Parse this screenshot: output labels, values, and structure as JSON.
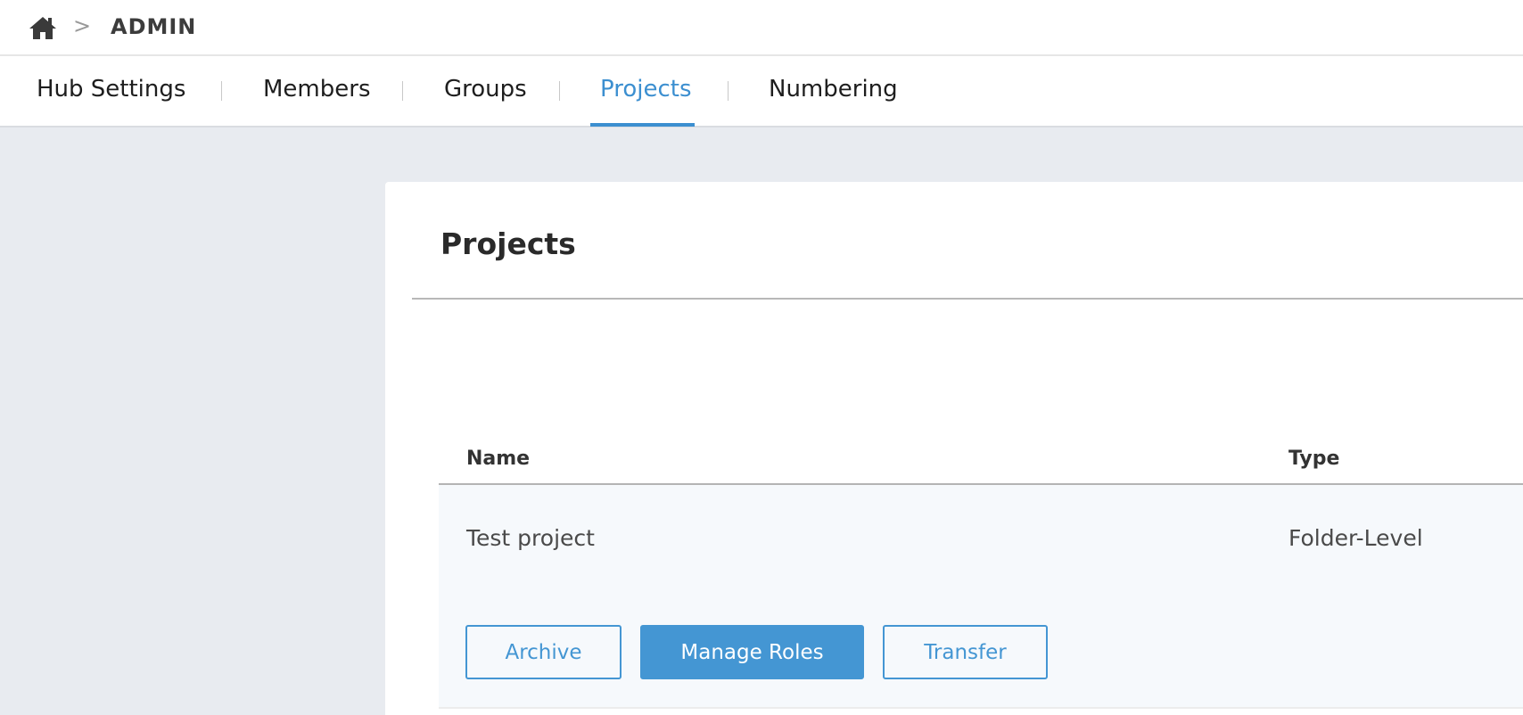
{
  "breadcrumb": {
    "home_icon": "home-icon",
    "separator": ">",
    "current": "ADMIN"
  },
  "tabs": [
    {
      "label": "Hub Settings",
      "active": false
    },
    {
      "label": "Members",
      "active": false
    },
    {
      "label": "Groups",
      "active": false
    },
    {
      "label": "Projects",
      "active": true
    },
    {
      "label": "Numbering",
      "active": false
    }
  ],
  "card": {
    "title": "Projects",
    "columns": {
      "name": "Name",
      "type": "Type"
    },
    "rows": [
      {
        "name": "Test project",
        "type": "Folder-Level"
      }
    ],
    "actions": {
      "archive": "Archive",
      "manage_roles": "Manage Roles",
      "transfer": "Transfer"
    }
  },
  "colors": {
    "accent": "#4496d3",
    "background": "#e8ebf0",
    "row_highlight": "#f6f9fc"
  }
}
